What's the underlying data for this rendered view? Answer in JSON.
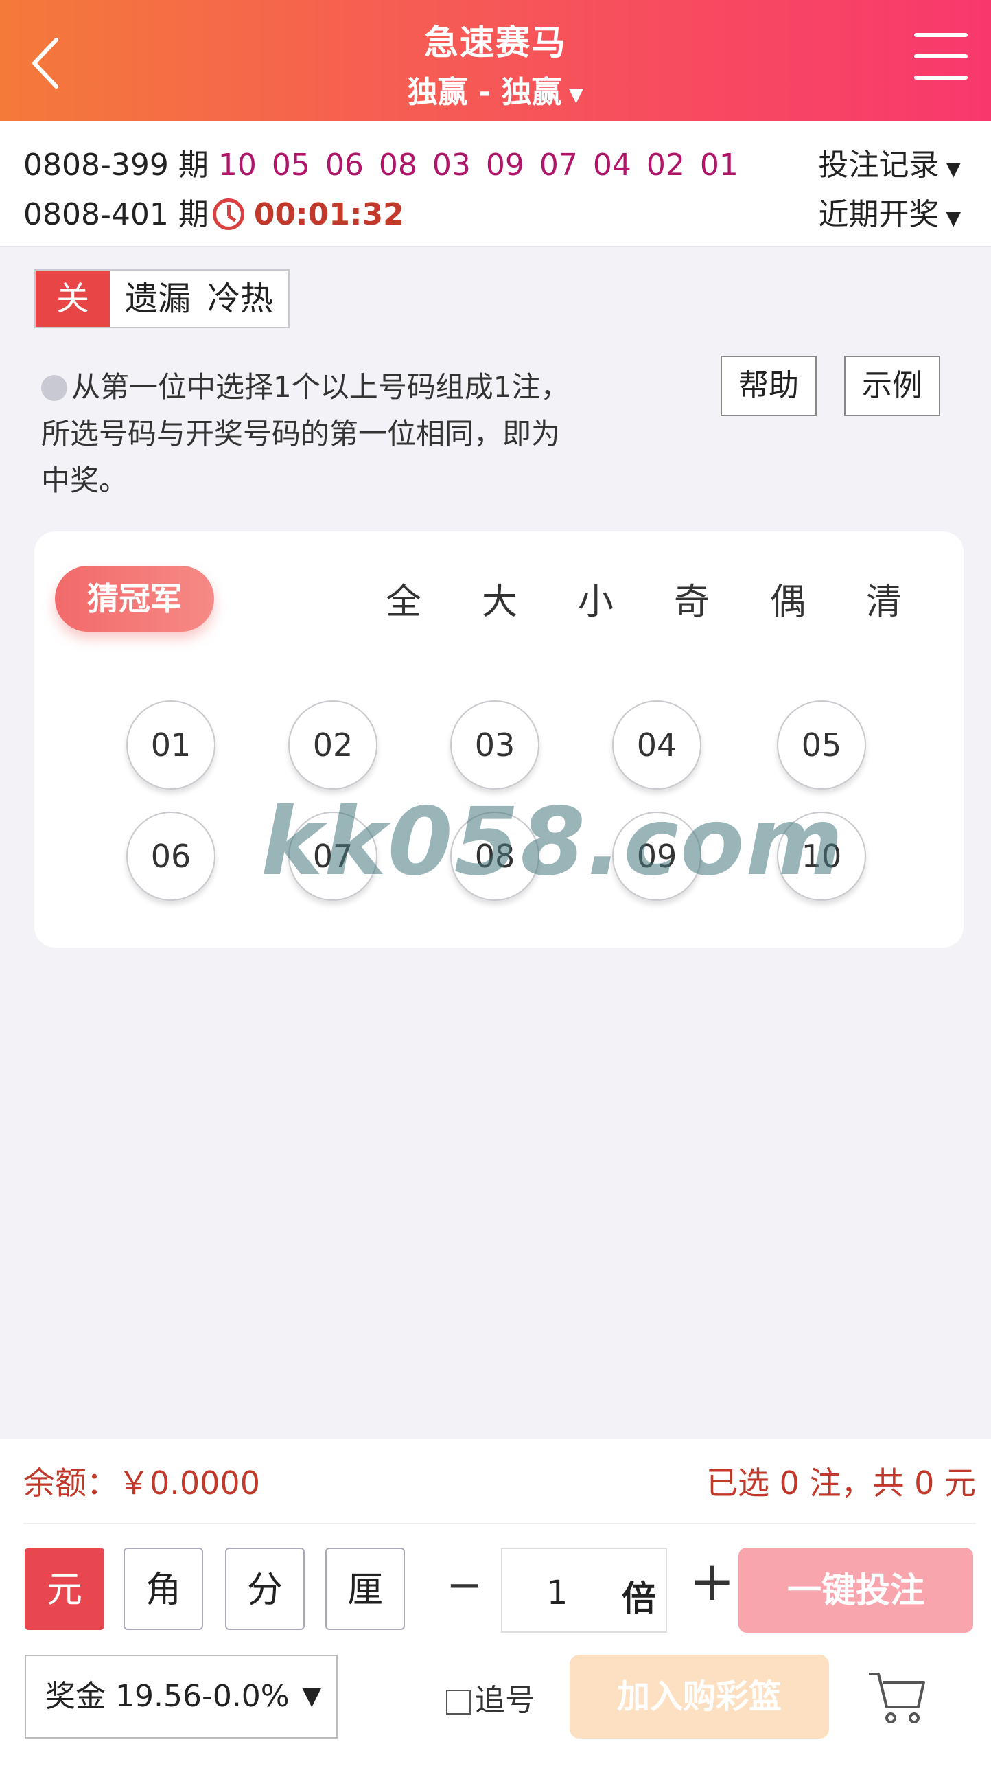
{
  "header": {
    "title": "急速赛马",
    "subtitle": "独赢 - 独赢"
  },
  "issue": {
    "prev_label": "0808-399 期",
    "prev_numbers": [
      "10",
      "05",
      "06",
      "08",
      "03",
      "09",
      "07",
      "04",
      "02",
      "01"
    ],
    "curr_label": "0808-401 期",
    "countdown": "00:01:32",
    "bet_record": "投注记录",
    "recent_draws": "近期开奖"
  },
  "toggle": {
    "off": "关",
    "missing": "遗漏",
    "hotcold": "冷热"
  },
  "rule": {
    "line1": "从第一位中选择1个以上号码组成1注，",
    "line2": "所选号码与开奖号码的第一位相同，即为",
    "line3": "中奖。",
    "help": "帮助",
    "example": "示例"
  },
  "picker": {
    "position_label": "猜冠军",
    "quick": [
      "全",
      "大",
      "小",
      "奇",
      "偶",
      "清"
    ],
    "balls": [
      "01",
      "02",
      "03",
      "04",
      "05",
      "06",
      "07",
      "08",
      "09",
      "10"
    ]
  },
  "watermark": "kk058.com",
  "footer": {
    "balance": "余额：￥0.0000",
    "selected": "已选 0 注，共 0 元",
    "units": [
      "元",
      "角",
      "分",
      "厘"
    ],
    "minus": "−",
    "multiplier": "1",
    "multiplier_unit": "倍",
    "plus": "+",
    "one_key_bet": "一键投注",
    "prize": "奖金 19.56-0.0%",
    "chase": "追号",
    "add_to_cart": "加入购彩篮"
  }
}
